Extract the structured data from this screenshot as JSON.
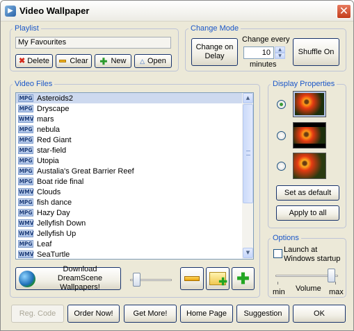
{
  "window": {
    "title": "Video Wallpaper",
    "close_glyph": "✕"
  },
  "playlist": {
    "legend": "Playlist",
    "name_value": "My Favourites",
    "delete_label": "Delete",
    "clear_label": "Clear",
    "new_label": "New",
    "open_label": "Open"
  },
  "change_mode": {
    "legend": "Change Mode",
    "on_delay_label": "Change on Delay",
    "every_label": "Change every",
    "every_value": "10",
    "unit_label": "minutes",
    "shuffle_label": "Shuffle On"
  },
  "video_files": {
    "legend": "Video Files",
    "items": [
      {
        "type": "MPG",
        "name": "Asteroids2"
      },
      {
        "type": "MPG",
        "name": "Dryscape"
      },
      {
        "type": "WMV",
        "name": "mars"
      },
      {
        "type": "MPG",
        "name": "nebula"
      },
      {
        "type": "MPG",
        "name": "Red Giant"
      },
      {
        "type": "MPG",
        "name": "star-field"
      },
      {
        "type": "MPG",
        "name": "Utopia"
      },
      {
        "type": "MPG",
        "name": "Austalia's Great Barrier Reef"
      },
      {
        "type": "MPG",
        "name": "Boat ride final"
      },
      {
        "type": "WMV",
        "name": "Clouds"
      },
      {
        "type": "MPG",
        "name": "fish dance"
      },
      {
        "type": "MPG",
        "name": "Hazy Day"
      },
      {
        "type": "WMV",
        "name": "Jellyfish Down"
      },
      {
        "type": "WMV",
        "name": "Jellyfish Up"
      },
      {
        "type": "MPG",
        "name": "Leaf"
      },
      {
        "type": "WMV",
        "name": "SeaTurtle"
      }
    ],
    "selected_index": 0
  },
  "dreamscene": {
    "download_label": "Download DreamScene Wallpapers!"
  },
  "display_properties": {
    "legend": "Display Properties",
    "selected_option": 1,
    "set_default_label": "Set as default",
    "apply_all_label": "Apply to all"
  },
  "options": {
    "legend": "Options",
    "launch_label": "Launch at Windows startup",
    "launch_checked": false,
    "volume_label": "Volume",
    "min_label": "min",
    "max_label": "max",
    "volume_level": 0.95
  },
  "footer": {
    "reg_code_label": "Reg. Code",
    "order_label": "Order Now!",
    "get_more_label": "Get More!",
    "home_label": "Home Page",
    "suggestion_label": "Suggestion",
    "ok_label": "OK"
  },
  "colors": {
    "accent": "#1a56c8",
    "selection": "#cdd9ef"
  }
}
